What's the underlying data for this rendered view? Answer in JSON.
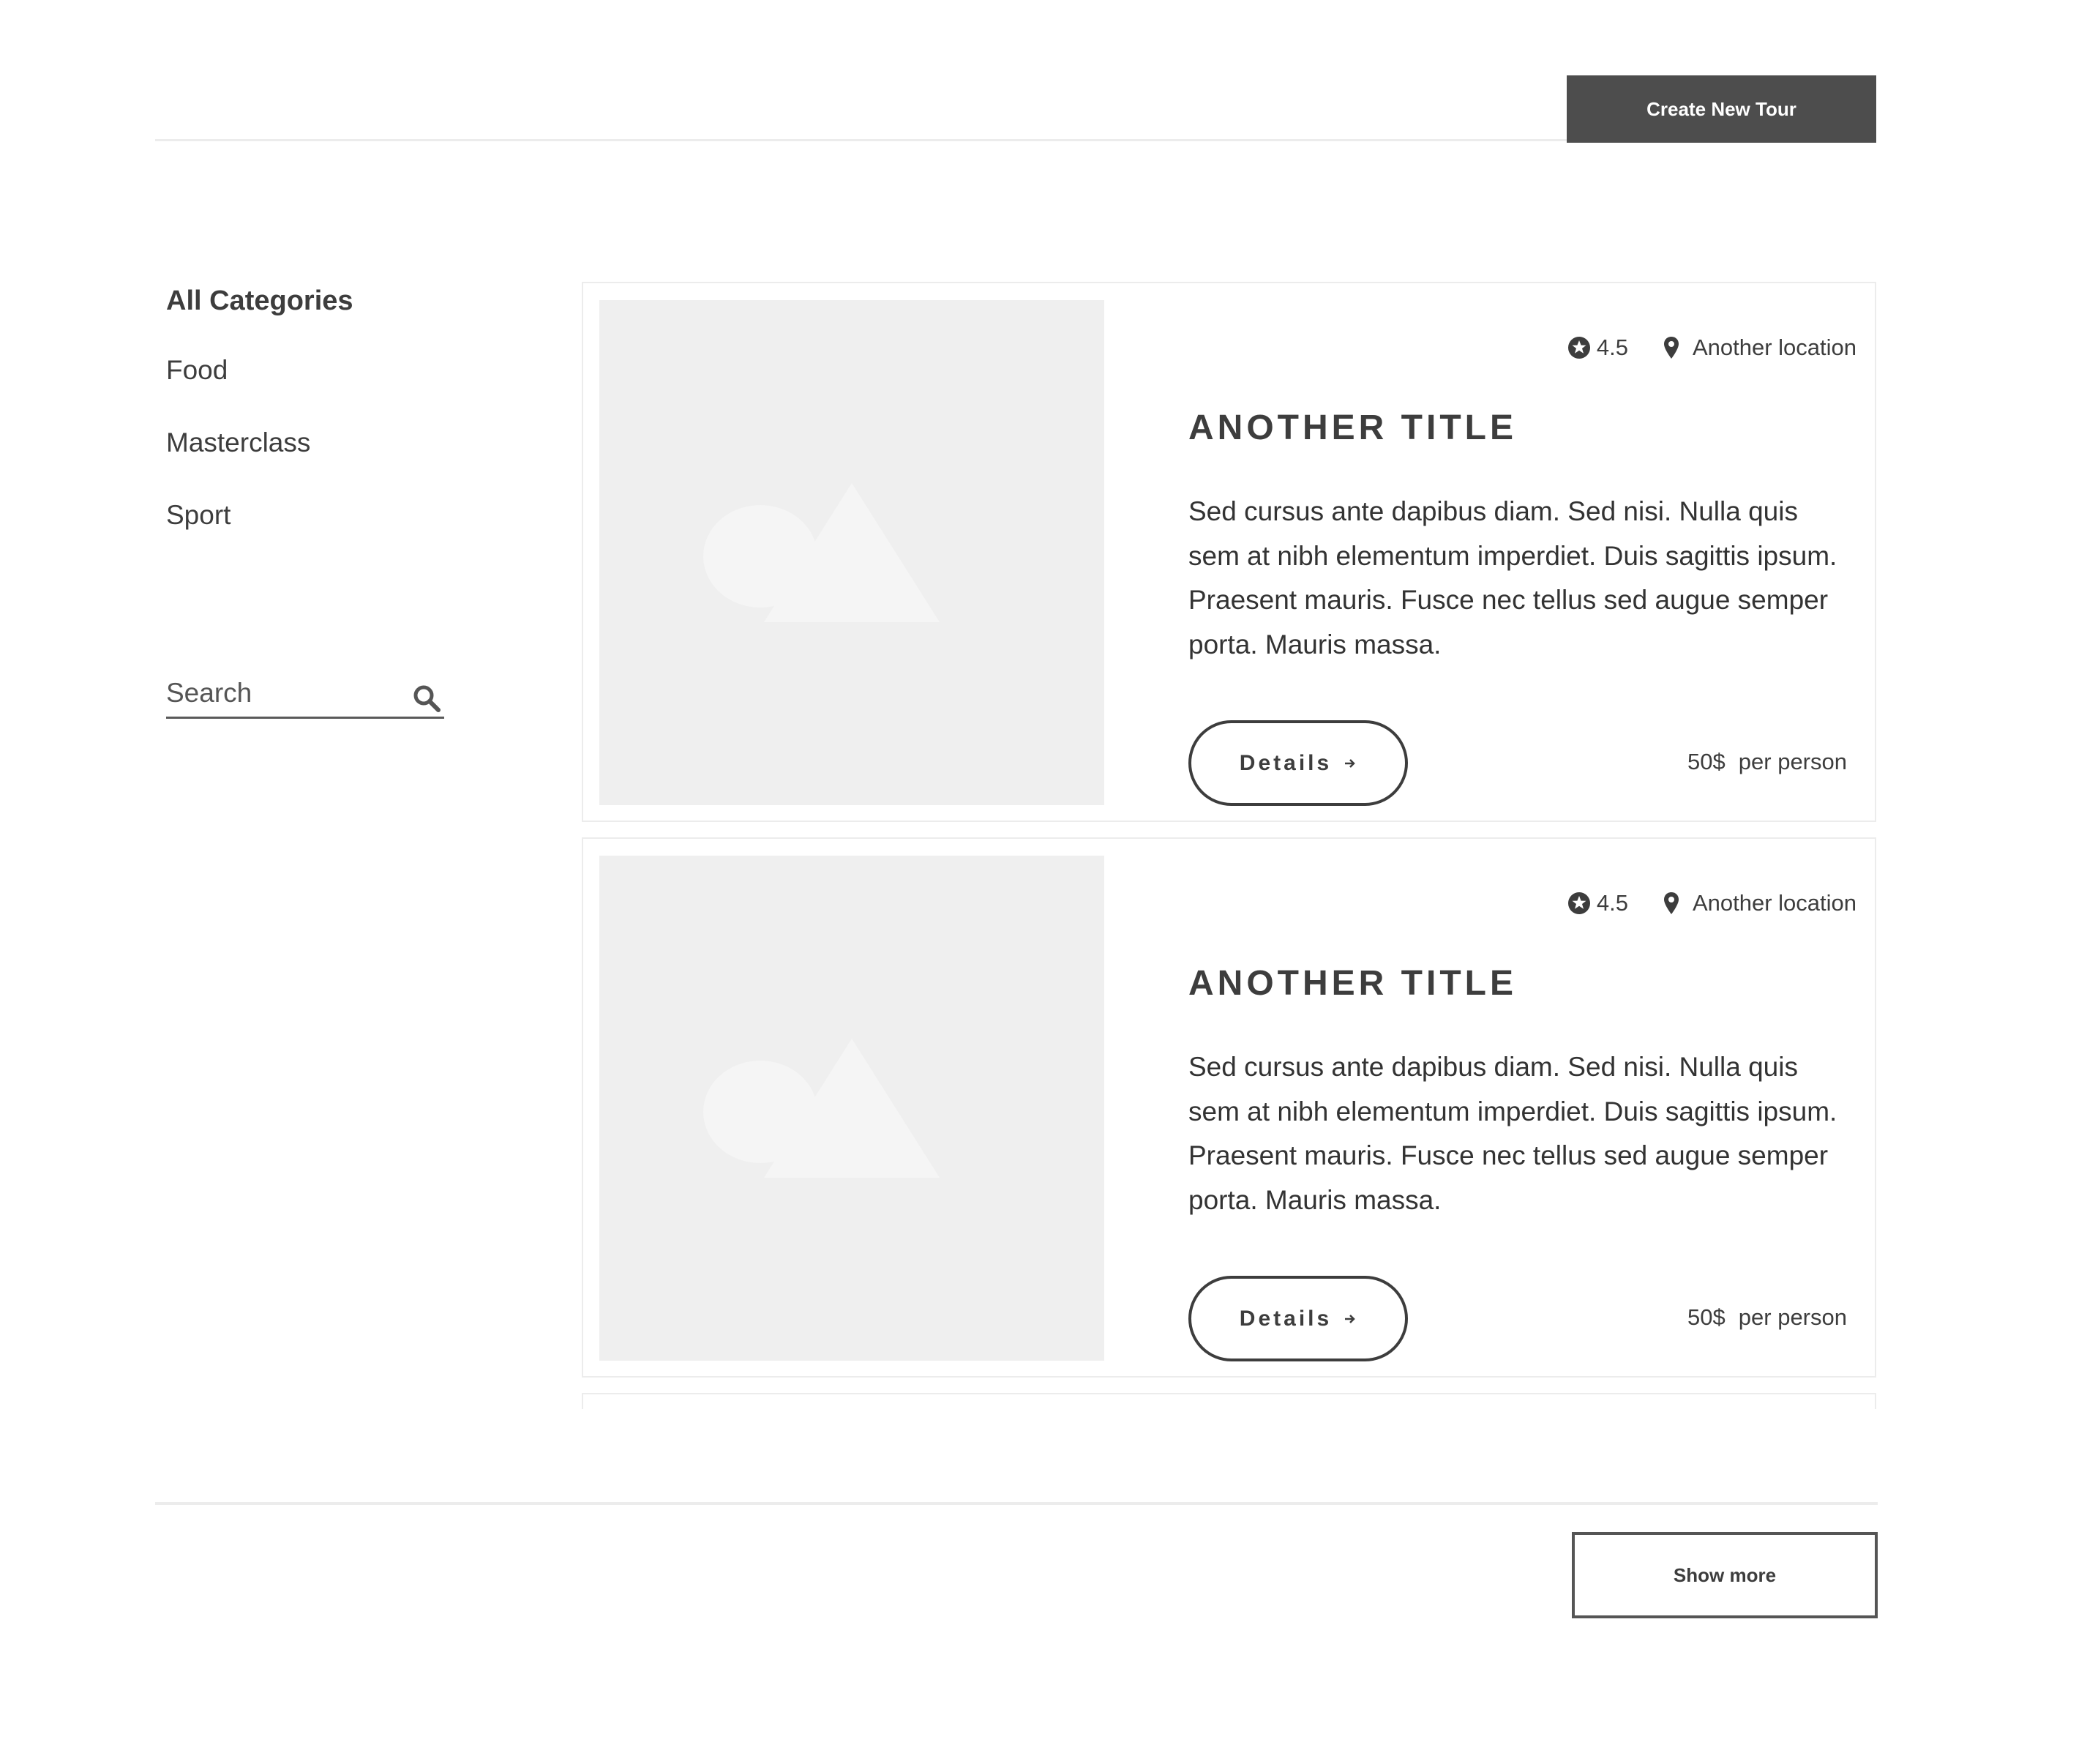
{
  "header": {
    "create_button_label": "Create New Tour"
  },
  "sidebar": {
    "categories": [
      {
        "label": "All Categories",
        "active": true
      },
      {
        "label": "Food",
        "active": false
      },
      {
        "label": "Masterclass",
        "active": false
      },
      {
        "label": "Sport",
        "active": false
      }
    ],
    "search": {
      "placeholder": "Search",
      "icon": "search-icon"
    }
  },
  "tours": [
    {
      "image_icon": "image-placeholder-icon",
      "rating": "4.5",
      "location": "Another location",
      "title": "ANOTHER TITLE",
      "description": "Sed cursus ante dapibus diam. Sed nisi. Nulla quis sem at nibh elementum imperdiet. Duis sagittis ipsum. Praesent mauris. Fusce nec tellus sed augue semper porta. Mauris massa.",
      "details_label": "Details",
      "price": "50$",
      "price_unit": "per person"
    },
    {
      "image_icon": "image-placeholder-icon",
      "rating": "4.5",
      "location": "Another location",
      "title": "ANOTHER TITLE",
      "description": "Sed cursus ante dapibus diam. Sed nisi. Nulla quis sem at nibh elementum imperdiet. Duis sagittis ipsum. Praesent mauris. Fusce nec tellus sed augue semper porta. Mauris massa.",
      "details_label": "Details",
      "price": "50$",
      "price_unit": "per person"
    }
  ],
  "footer": {
    "show_more_label": "Show more"
  },
  "colors": {
    "primary_button": "#4d4d4d",
    "text": "#3d3d3d",
    "border": "#ececec",
    "image_placeholder": "#efefef"
  }
}
